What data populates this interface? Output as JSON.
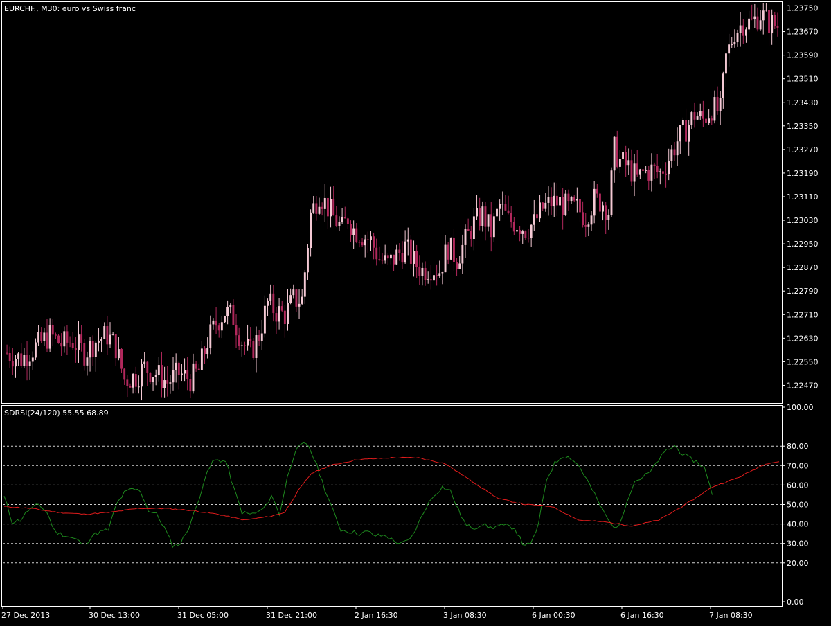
{
  "colors": {
    "background": "#000000",
    "frame": "#ffffff",
    "text": "#ffffff",
    "bull_candle": "#f4c9d4",
    "bear_candle": "#b2285c",
    "fast_line": "#1e8a1e",
    "slow_line": "#e01c1c",
    "level_grid": "#cfcfcf"
  },
  "chart_data": [
    {
      "type": "candlestick",
      "title": "EURCHF., M30:  euro vs Swiss franc",
      "ylim": [
        1.2241,
        1.2377
      ],
      "price_ticks": [
        "1.23750",
        "1.23670",
        "1.23590",
        "1.23510",
        "1.23430",
        "1.23350",
        "1.23270",
        "1.23190",
        "1.23110",
        "1.23030",
        "1.22950",
        "1.22870",
        "1.22790",
        "1.22710",
        "1.22630",
        "1.22550",
        "1.22470"
      ],
      "close_path": [
        [
          0,
          1.2258
        ],
        [
          5,
          1.2256
        ],
        [
          10,
          1.226
        ],
        [
          15,
          1.2264
        ],
        [
          19,
          1.2261
        ],
        [
          23,
          1.2262
        ],
        [
          27,
          1.2258
        ],
        [
          31,
          1.2262
        ],
        [
          35,
          1.2264
        ],
        [
          38,
          1.226
        ],
        [
          41,
          1.2249
        ],
        [
          45,
          1.225
        ],
        [
          48,
          1.2253
        ],
        [
          52,
          1.2251
        ],
        [
          56,
          1.2248
        ],
        [
          60,
          1.2251
        ],
        [
          64,
          1.2249
        ],
        [
          67,
          1.2252
        ],
        [
          70,
          1.2262
        ],
        [
          73,
          1.2268
        ],
        [
          76,
          1.2272
        ],
        [
          79,
          1.227
        ],
        [
          82,
          1.2262
        ],
        [
          85,
          1.2258
        ],
        [
          88,
          1.2264
        ],
        [
          91,
          1.2275
        ],
        [
          94,
          1.2272
        ],
        [
          97,
          1.2271
        ],
        [
          100,
          1.2276
        ],
        [
          103,
          1.2276
        ],
        [
          106,
          1.2305
        ],
        [
          109,
          1.2312
        ],
        [
          111,
          1.2309
        ],
        [
          114,
          1.2304
        ],
        [
          117,
          1.23
        ],
        [
          119,
          1.2304
        ],
        [
          121,
          1.23
        ],
        [
          124,
          1.2298
        ],
        [
          127,
          1.2296
        ],
        [
          130,
          1.229
        ],
        [
          133,
          1.2288
        ],
        [
          136,
          1.2291
        ],
        [
          139,
          1.2294
        ],
        [
          142,
          1.2289
        ],
        [
          145,
          1.2286
        ],
        [
          148,
          1.2287
        ],
        [
          151,
          1.2286
        ],
        [
          154,
          1.2294
        ],
        [
          157,
          1.229
        ],
        [
          160,
          1.2296
        ],
        [
          163,
          1.2302
        ],
        [
          166,
          1.2305
        ],
        [
          169,
          1.2299
        ],
        [
          172,
          1.2308
        ],
        [
          175,
          1.2303
        ],
        [
          178,
          1.2302
        ],
        [
          181,
          1.23
        ],
        [
          184,
          1.2302
        ],
        [
          187,
          1.2307
        ],
        [
          190,
          1.2309
        ],
        [
          193,
          1.2309
        ],
        [
          196,
          1.2307
        ],
        [
          199,
          1.2307
        ],
        [
          202,
          1.2304
        ],
        [
          205,
          1.231
        ],
        [
          208,
          1.2309
        ],
        [
          210,
          1.2306
        ],
        [
          212,
          1.2327
        ],
        [
          214,
          1.2323
        ],
        [
          217,
          1.2321
        ],
        [
          220,
          1.2317
        ],
        [
          222,
          1.2319
        ],
        [
          225,
          1.232
        ],
        [
          228,
          1.2319
        ],
        [
          231,
          1.2324
        ],
        [
          234,
          1.233
        ],
        [
          237,
          1.2334
        ],
        [
          240,
          1.2339
        ],
        [
          243,
          1.2337
        ],
        [
          246,
          1.2341
        ],
        [
          249,
          1.234
        ],
        [
          251,
          1.2358
        ],
        [
          254,
          1.2367
        ],
        [
          257,
          1.237
        ],
        [
          260,
          1.237
        ],
        [
          263,
          1.2373
        ],
        [
          266,
          1.237
        ],
        [
          269,
          1.2369
        ]
      ]
    },
    {
      "type": "line",
      "title": "SDRSI(24/120) 55.55 68.89",
      "ylim": [
        0,
        100
      ],
      "level_ticks": [
        "100.00",
        "80.00",
        "70.00",
        "60.00",
        "50.00",
        "40.00",
        "30.00",
        "20.00",
        "0.00"
      ],
      "levels": [
        80,
        70,
        60,
        50,
        40,
        30,
        20
      ],
      "categories": [
        "27 Dec 2013",
        "30 Dec 13:00",
        "31 Dec 05:00",
        "31 Dec 21:00",
        "2 Jan 16:30",
        "3 Jan 08:30",
        "6 Jan 00:30",
        "6 Jan 16:30",
        "7 Jan 08:30"
      ],
      "series": [
        {
          "role": "fast",
          "points": [
            [
              0,
              54
            ],
            [
              3,
              41
            ],
            [
              6,
              42
            ],
            [
              9,
              47
            ],
            [
              13,
              50
            ],
            [
              16,
              46
            ],
            [
              19,
              36
            ],
            [
              23,
              34
            ],
            [
              27,
              32
            ],
            [
              30,
              29
            ],
            [
              33,
              34
            ],
            [
              36,
              36
            ],
            [
              39,
              37
            ],
            [
              42,
              50
            ],
            [
              45,
              56
            ],
            [
              48,
              58
            ],
            [
              51,
              57
            ],
            [
              54,
              47
            ],
            [
              57,
              45
            ],
            [
              60,
              38
            ],
            [
              63,
              29
            ],
            [
              66,
              30
            ],
            [
              69,
              38
            ],
            [
              72,
              49
            ],
            [
              75,
              63
            ],
            [
              78,
              72
            ],
            [
              80,
              73
            ],
            [
              83,
              72
            ],
            [
              86,
              58
            ],
            [
              89,
              46
            ],
            [
              92,
              45
            ],
            [
              95,
              46
            ],
            [
              98,
              49
            ],
            [
              100,
              55
            ],
            [
              103,
              45
            ],
            [
              106,
              64
            ],
            [
              109,
              78
            ],
            [
              112,
              81
            ],
            [
              114,
              80
            ],
            [
              117,
              70
            ],
            [
              120,
              58
            ],
            [
              123,
              47
            ],
            [
              126,
              37
            ],
            [
              130,
              36
            ],
            [
              133,
              35
            ],
            [
              136,
              36
            ],
            [
              139,
              34
            ],
            [
              143,
              34
            ],
            [
              146,
              31
            ],
            [
              149,
              30
            ],
            [
              152,
              32
            ],
            [
              155,
              40
            ],
            [
              158,
              49
            ],
            [
              161,
              55
            ],
            [
              164,
              59
            ],
            [
              167,
              57
            ],
            [
              170,
              47
            ],
            [
              173,
              39
            ],
            [
              176,
              38
            ],
            [
              179,
              40
            ],
            [
              182,
              38
            ],
            [
              185,
              39
            ],
            [
              188,
              39
            ],
            [
              191,
              38
            ],
            [
              194,
              30
            ],
            [
              197,
              29
            ],
            [
              200,
              40
            ],
            [
              203,
              63
            ],
            [
              206,
              71
            ],
            [
              209,
              75
            ],
            [
              212,
              74
            ],
            [
              215,
              70
            ],
            [
              218,
              63
            ],
            [
              221,
              55
            ],
            [
              224,
              47
            ],
            [
              227,
              40
            ],
            [
              230,
              38
            ],
            [
              233,
              52
            ],
            [
              236,
              62
            ],
            [
              239,
              64
            ],
            [
              242,
              67
            ],
            [
              245,
              73
            ],
            [
              248,
              78
            ],
            [
              251,
              80
            ],
            [
              253,
              77
            ],
            [
              256,
              74
            ],
            [
              259,
              72
            ],
            [
              262,
              69
            ],
            [
              265,
              55
            ]
          ]
        },
        {
          "role": "slow",
          "points": [
            [
              0,
              49
            ],
            [
              10,
              48
            ],
            [
              20,
              46
            ],
            [
              30,
              45
            ],
            [
              40,
              46
            ],
            [
              50,
              48
            ],
            [
              60,
              48
            ],
            [
              70,
              47
            ],
            [
              80,
              45
            ],
            [
              90,
              42
            ],
            [
              100,
              44
            ],
            [
              105,
              46
            ],
            [
              110,
              57
            ],
            [
              115,
              66
            ],
            [
              122,
              70
            ],
            [
              132,
              73
            ],
            [
              145,
              74
            ],
            [
              155,
              74
            ],
            [
              165,
              71
            ],
            [
              175,
              62
            ],
            [
              185,
              53
            ],
            [
              195,
              50
            ],
            [
              205,
              49
            ],
            [
              215,
              42
            ],
            [
              225,
              41
            ],
            [
              235,
              39
            ],
            [
              245,
              42
            ],
            [
              255,
              50
            ],
            [
              265,
              59
            ],
            [
              275,
              64
            ],
            [
              285,
              71
            ],
            [
              290,
              72
            ]
          ]
        }
      ]
    }
  ]
}
